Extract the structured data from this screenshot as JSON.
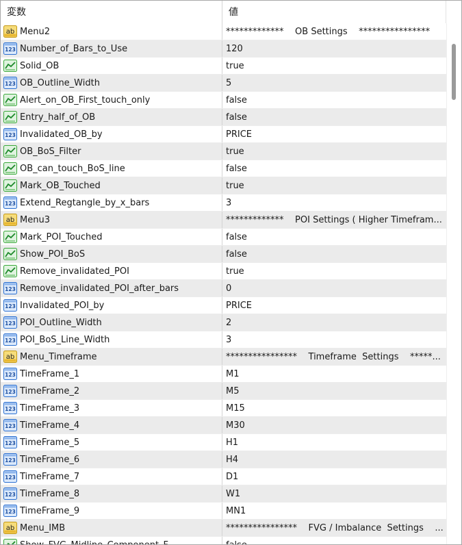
{
  "header": {
    "col_variable": "変数",
    "col_value": "値"
  },
  "rows": [
    {
      "type": "string",
      "name": "Menu2",
      "value": "*************    OB Settings    ****************"
    },
    {
      "type": "int",
      "name": "Number_of_Bars_to_Use",
      "value": "120"
    },
    {
      "type": "bool",
      "name": "Solid_OB",
      "value": "true"
    },
    {
      "type": "int",
      "name": "OB_Outline_Width",
      "value": "5"
    },
    {
      "type": "bool",
      "name": "Alert_on_OB_First_touch_only",
      "value": "false"
    },
    {
      "type": "bool",
      "name": "Entry_half_of_OB",
      "value": "false"
    },
    {
      "type": "int",
      "name": "Invalidated_OB_by",
      "value": "PRICE"
    },
    {
      "type": "bool",
      "name": "OB_BoS_Filter",
      "value": "true"
    },
    {
      "type": "bool",
      "name": "OB_can_touch_BoS_line",
      "value": "false"
    },
    {
      "type": "bool",
      "name": "Mark_OB_Touched",
      "value": "true"
    },
    {
      "type": "int",
      "name": "Extend_Regtangle_by_x_bars",
      "value": "3"
    },
    {
      "type": "string",
      "name": "Menu3",
      "value": "*************    POI Settings ( Higher Timefram..."
    },
    {
      "type": "bool",
      "name": "Mark_POI_Touched",
      "value": "false"
    },
    {
      "type": "bool",
      "name": "Show_POI_BoS",
      "value": "false"
    },
    {
      "type": "bool",
      "name": "Remove_invalidated_POI",
      "value": "true"
    },
    {
      "type": "int",
      "name": "Remove_invalidated_POI_after_bars",
      "value": "0"
    },
    {
      "type": "int",
      "name": "Invalidated_POI_by",
      "value": "PRICE"
    },
    {
      "type": "int",
      "name": "POI_Outline_Width",
      "value": "2"
    },
    {
      "type": "int",
      "name": "POI_BoS_Line_Width",
      "value": "3"
    },
    {
      "type": "string",
      "name": "Menu_Timeframe",
      "value": "****************    Timeframe  Settings    *****..."
    },
    {
      "type": "int",
      "name": "TimeFrame_1",
      "value": "M1"
    },
    {
      "type": "int",
      "name": "TimeFrame_2",
      "value": "M5"
    },
    {
      "type": "int",
      "name": "TimeFrame_3",
      "value": "M15"
    },
    {
      "type": "int",
      "name": "TimeFrame_4",
      "value": "M30"
    },
    {
      "type": "int",
      "name": "TimeFrame_5",
      "value": "H1"
    },
    {
      "type": "int",
      "name": "TimeFrame_6",
      "value": "H4"
    },
    {
      "type": "int",
      "name": "TimeFrame_7",
      "value": "D1"
    },
    {
      "type": "int",
      "name": "TimeFrame_8",
      "value": "W1"
    },
    {
      "type": "int",
      "name": "TimeFrame_9",
      "value": "MN1"
    },
    {
      "type": "string",
      "name": "Menu_IMB",
      "value": "****************    FVG / Imbalance  Settings    ..."
    },
    {
      "type": "bool",
      "name": "Show_FVG_Midline_Component_F",
      "value": "false"
    }
  ],
  "icons": {
    "string": "ab-string-icon",
    "int": "123-integer-icon",
    "bool": "boolean-chart-icon"
  },
  "colors": {
    "alt_row": "#ebebeb",
    "string_icon": "#f2c94c",
    "int_icon": "#2a6fd1",
    "bool_icon": "#3aa83a"
  }
}
